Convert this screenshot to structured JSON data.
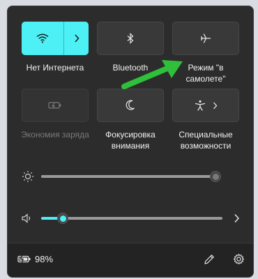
{
  "tiles": {
    "wifi": {
      "label": "Нет Интернета",
      "state": "on"
    },
    "bluetooth": {
      "label": "Bluetooth",
      "state": "off"
    },
    "airplane": {
      "label": "Режим \"в самолете\"",
      "state": "off"
    },
    "battery_saver": {
      "label": "Экономия заряда",
      "state": "disabled"
    },
    "focus": {
      "label": "Фокусировка внимания",
      "state": "off"
    },
    "accessibility": {
      "label": "Специальные возможности",
      "state": "off"
    }
  },
  "brightness": {
    "icon": "sun-icon",
    "level": 1.0
  },
  "volume": {
    "icon": "speaker-icon",
    "level": 0.12
  },
  "footer": {
    "battery_percent": "98%"
  },
  "colors": {
    "accent": "#4cf0f5",
    "panel_bg": "#2c2c2c",
    "tile_bg": "#393939",
    "annotation_arrow": "#2fbf3a"
  }
}
